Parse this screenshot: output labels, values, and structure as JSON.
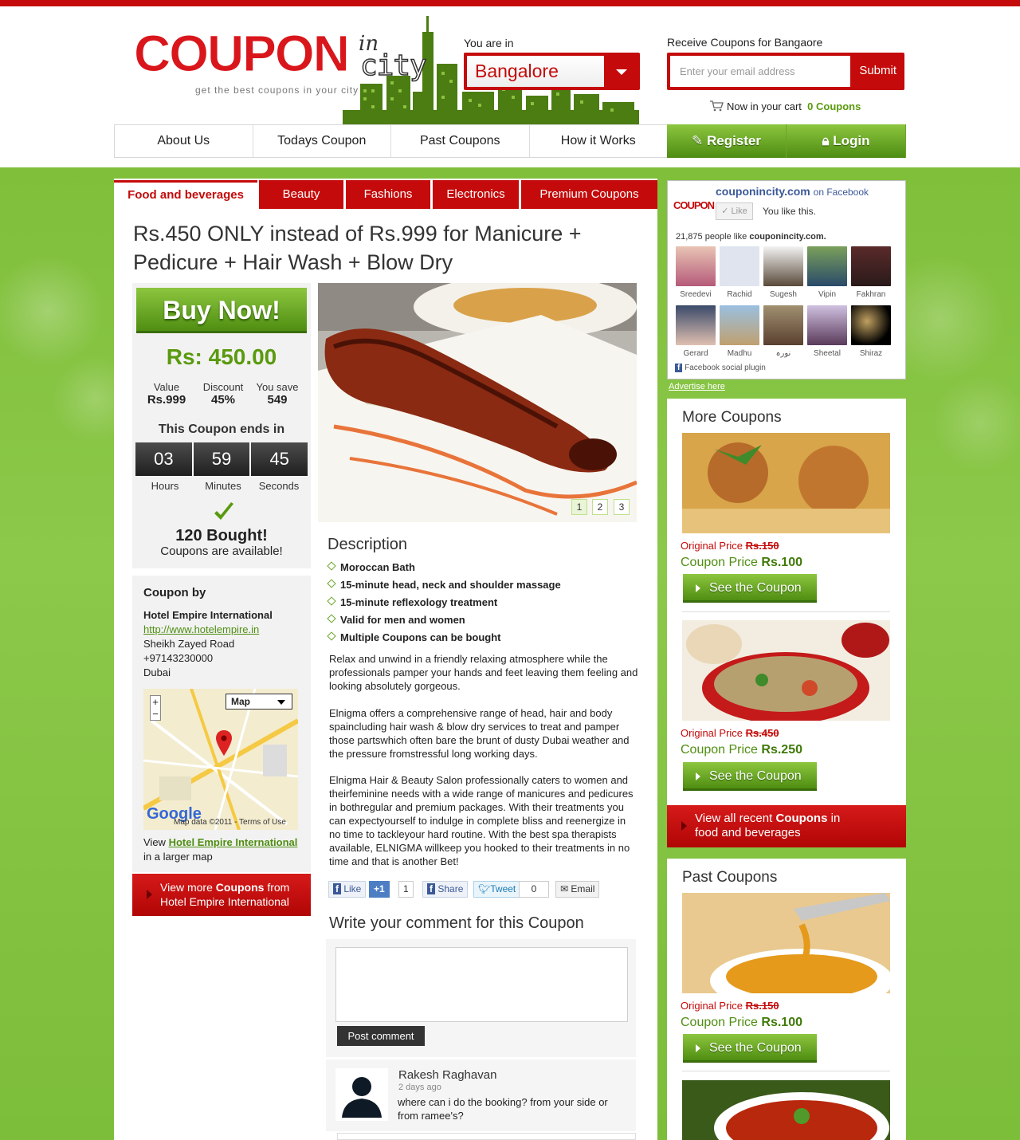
{
  "brand": {
    "logo_word": "COUPON",
    "logo_in": "in",
    "logo_city": "city",
    "tagline": "get the best coupons in your city"
  },
  "location": {
    "label": "You are in",
    "city": "Bangalore"
  },
  "subscribe": {
    "label": "Receive Coupons for Bangaore",
    "placeholder": "Enter your email address",
    "submit": "Submit"
  },
  "cart": {
    "label": "Now in your cart",
    "count": "0 Coupons"
  },
  "nav": {
    "items": [
      "About Us",
      "Todays Coupon",
      "Past Coupons",
      "How it Works"
    ],
    "register": "Register",
    "login": "Login"
  },
  "tabs": [
    "Food and beverages",
    "Beauty",
    "Fashions",
    "Electronics",
    "Premium Coupons"
  ],
  "deal": {
    "title": "Rs.450 ONLY instead of Rs.999 for Manicure + Pedicure + Hair Wash + Blow Dry",
    "buy_label": "Buy Now!",
    "price": "Rs: 450.00",
    "value_label": "Value",
    "value": "Rs.999",
    "discount_label": "Discount",
    "discount": "45%",
    "save_label": "You save",
    "save": "549",
    "ends_label": "This Coupon ends in",
    "hours": "03",
    "minutes": "59",
    "seconds": "45",
    "hours_label": "Hours",
    "minutes_label": "Minutes",
    "seconds_label": "Seconds",
    "bought": "120 Bought!",
    "available": "Coupons are available!",
    "pages": [
      "1",
      "2",
      "3"
    ]
  },
  "merchant": {
    "heading": "Coupon by",
    "name": "Hotel Empire International",
    "url": "http://www.hotelempire.in",
    "address": "Sheikh Zayed Road",
    "phone": "+97143230000",
    "city": "Dubai",
    "map_type": "Map",
    "map_credit": "Map data ©2011 - Terms of Use",
    "view_prefix": "View",
    "view_link": "Hotel Empire International",
    "view_suffix": "in a larger map",
    "more_prefix": "View more",
    "more_bold": "Coupons",
    "more_suffix": "from",
    "more_line2": "Hotel Empire International"
  },
  "description": {
    "heading": "Description",
    "bullets": [
      "Moroccan Bath",
      "15-minute head, neck and shoulder massage",
      "15-minute reflexology treatment",
      "Valid for men and women",
      "Multiple Coupons can be bought"
    ],
    "paragraphs": [
      "Relax and unwind in a friendly relaxing atmosphere while the professionals pamper your hands and feet leaving them feeling and looking absolutely gorgeous.",
      "Elnigma offers a comprehensive range of head, hair and body spaincluding hair wash & blow dry services to treat and pamper those partswhich often bare the brunt of dusty Dubai weather and the pressure fromstressful long working days.",
      "Elnigma Hair & Beauty Salon professionally caters to women and theirfeminine needs with a wide range of manicures and pedicures in bothregular and premium packages. With their treatments you can expectyourself to indulge in complete bliss and reenergize in no time to tackleyour hard routine. With the best spa therapists available, ELNIGMA willkeep you hooked to their treatments in no time and that is another Bet!"
    ]
  },
  "share": {
    "like": "Like",
    "plus": "+1",
    "plus_count": "1",
    "share": "Share",
    "tweet": "Tweet",
    "tweet_count": "0",
    "email": "Email"
  },
  "comments": {
    "heading": "Write your comment for this Coupon",
    "post": "Post comment",
    "items": [
      {
        "name": "Rakesh Raghavan",
        "time": "2 days ago",
        "text": "where can i do the booking? from your side or from ramee's?"
      }
    ]
  },
  "facebook": {
    "page": "couponincity.com",
    "on": "on Facebook",
    "logo": "COUPON",
    "like": "Like",
    "you_like": "You like this.",
    "count_prefix": "21,875 people like",
    "count_page": "couponincity.com.",
    "fans": [
      "Sreedevi",
      "Rachid",
      "Sugesh",
      "Vipin",
      "Fakhran",
      "Gerard",
      "Madhu",
      "نورہ",
      "Sheetal",
      "Shiraz"
    ],
    "plugin": "Facebook social plugin"
  },
  "advertise": "Advertise here",
  "more_coupons": {
    "heading": "More Coupons",
    "items": [
      {
        "orig_label": "Original Price",
        "orig": "Rs.150",
        "price_label": "Coupon Price",
        "price": "Rs.100",
        "button": "See the Coupon"
      },
      {
        "orig_label": "Original Price",
        "orig": "Rs.450",
        "price_label": "Coupon Price",
        "price": "Rs.250",
        "button": "See the Coupon"
      }
    ],
    "view_all_prefix": "View all recent",
    "view_all_bold": "Coupons",
    "view_all_suffix": "in",
    "view_all_line2": "food and beverages"
  },
  "past_coupons": {
    "heading": "Past Coupons",
    "items": [
      {
        "orig_label": "Original Price",
        "orig": "Rs.150",
        "price_label": "Coupon Price",
        "price": "Rs.100",
        "button": "See the Coupon"
      }
    ]
  },
  "colors": {
    "brand_red": "#c40a0a",
    "brand_green": "#5a9a0e",
    "facebook_blue": "#3b5998"
  }
}
